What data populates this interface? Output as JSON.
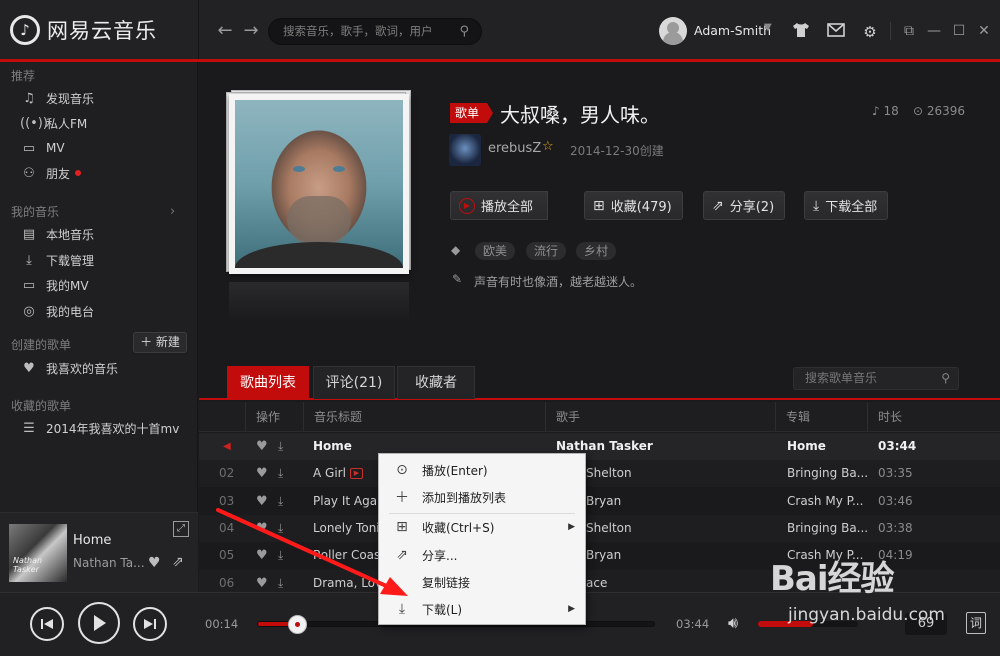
{
  "app": {
    "logo_text": "网易云音乐",
    "logo_glyph": "♪",
    "search_placeholder": "搜索音乐，歌手，歌词，用户",
    "username": "Adam-Smith"
  },
  "sidebar": {
    "sections": [
      {
        "title": "推荐",
        "items": [
          {
            "label": "发现音乐",
            "icon": "music-note-icon"
          },
          {
            "label": "私人FM",
            "icon": "radio-icon"
          },
          {
            "label": "MV",
            "icon": "tv-icon"
          },
          {
            "label": "朋友",
            "icon": "friends-icon"
          }
        ]
      },
      {
        "title": "我的音乐",
        "items": [
          {
            "label": "本地音乐",
            "icon": "local-music-icon"
          },
          {
            "label": "下载管理",
            "icon": "download-icon"
          },
          {
            "label": "我的MV",
            "icon": "my-mv-icon"
          },
          {
            "label": "我的电台",
            "icon": "my-radio-icon"
          }
        ]
      },
      {
        "title": "创建的歌单",
        "items": [
          {
            "label": "我喜欢的音乐",
            "icon": "heart-icon"
          }
        ]
      },
      {
        "title": "收藏的歌单",
        "items": [
          {
            "label": "2014年我喜欢的十首mv",
            "icon": "playlist-icon"
          }
        ]
      }
    ],
    "new_button": "＋ 新建"
  },
  "mini_player": {
    "title": "Home",
    "artist": "Nathan Ta...",
    "cover_text": "Nathan Tasker"
  },
  "playlist": {
    "badge": "歌单",
    "title": "大叔嗓，男人味。",
    "track_count": "18",
    "play_count": "26396",
    "creator": "erebusZ",
    "created": "2014-12-30创建",
    "actions": {
      "play_all": "播放全部",
      "collect": "收藏(479)",
      "share": "分享(2)",
      "download_all": "下载全部"
    },
    "tags": [
      "欧美",
      "流行",
      "乡村"
    ],
    "description": "声音有时也像酒，越老越迷人。"
  },
  "tabs": [
    {
      "label": "歌曲列表",
      "active": true
    },
    {
      "label": "评论(21)",
      "active": false
    },
    {
      "label": "收藏者",
      "active": false
    }
  ],
  "list_search_placeholder": "搜索歌单音乐",
  "table": {
    "headers": [
      "操作",
      "音乐标题",
      "歌手",
      "专辑",
      "时长"
    ],
    "rows": [
      {
        "num": "",
        "title": "Home",
        "artist": "Nathan Tasker",
        "album": "Home",
        "duration": "03:44",
        "current": true,
        "mv": false
      },
      {
        "num": "02",
        "title": "A Girl",
        "artist": "Shelton",
        "album": "Bringing Ba...",
        "duration": "03:35",
        "current": false,
        "mv": true
      },
      {
        "num": "03",
        "title": "Play It Again",
        "artist": "Bryan",
        "album": "Crash My P...",
        "duration": "03:46",
        "current": false,
        "mv": false
      },
      {
        "num": "04",
        "title": "Lonely Tonig",
        "artist": "Shelton",
        "album": "Bringing Ba...",
        "duration": "03:38",
        "current": false,
        "mv": false
      },
      {
        "num": "05",
        "title": "Roller Coas",
        "artist": "Bryan",
        "album": "Crash My P...",
        "duration": "04:19",
        "current": false,
        "mv": false
      },
      {
        "num": "06",
        "title": "Drama, Love",
        "artist": "ace",
        "album": "",
        "duration": "",
        "current": false,
        "mv": false
      }
    ]
  },
  "context_menu": {
    "items": [
      {
        "label": "播放(Enter)",
        "icon": "play-circle-icon",
        "submenu": false
      },
      {
        "label": "添加到播放列表",
        "icon": "plus-icon",
        "submenu": false
      },
      {
        "label": "收藏(Ctrl+S)",
        "icon": "collect-icon",
        "submenu": true
      },
      {
        "label": "分享...",
        "icon": "share-icon",
        "submenu": false
      },
      {
        "label": "复制链接",
        "icon": "link-icon",
        "submenu": false
      },
      {
        "label": "下载(L)",
        "icon": "download-icon",
        "submenu": true
      }
    ]
  },
  "player": {
    "elapsed": "00:14",
    "total": "03:44",
    "progress_fraction": 0.064,
    "volume_fraction": 0.55,
    "counter": "69",
    "lyric_label": "词"
  },
  "watermark": {
    "logo": "Bai经验",
    "url": "jingyan.baidu.com"
  },
  "colors": {
    "accent": "#c20c0c",
    "background": "#1a1a1c"
  }
}
